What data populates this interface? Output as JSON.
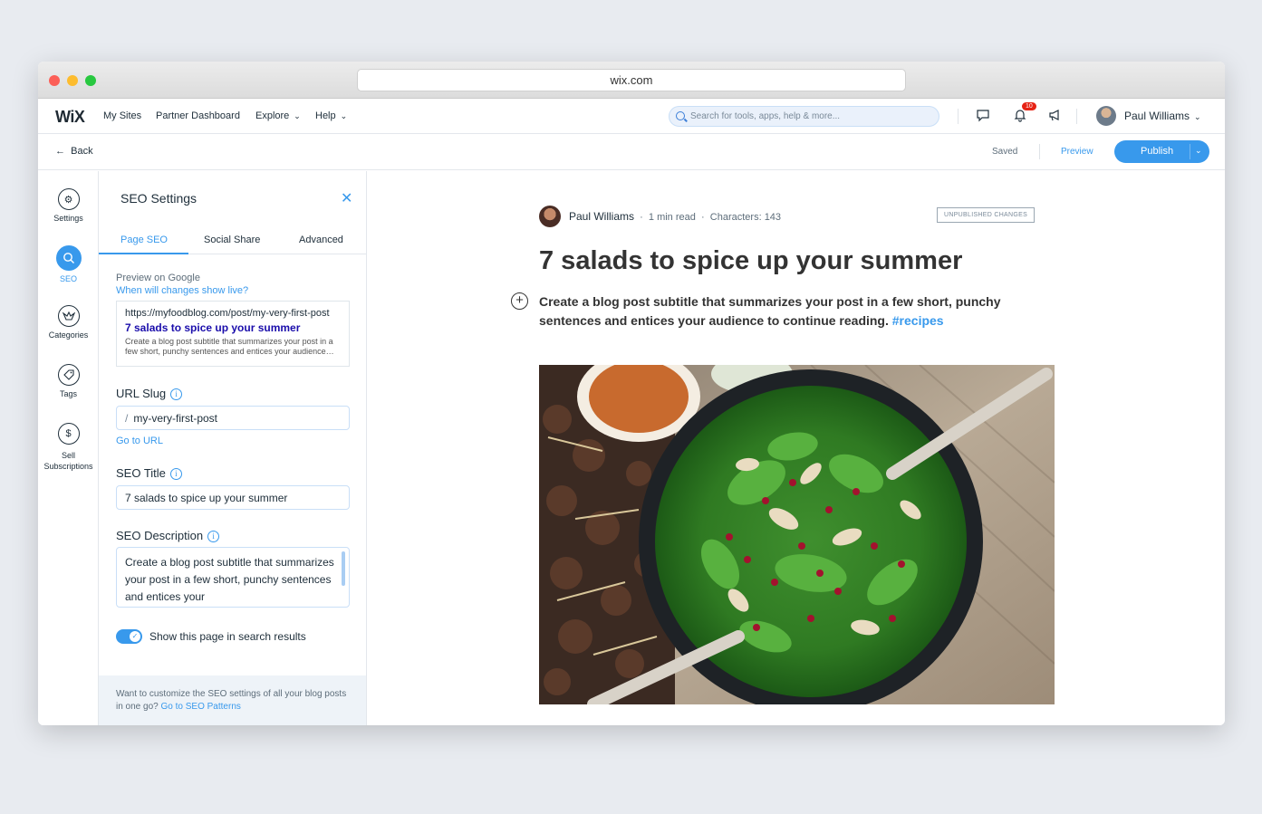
{
  "browser": {
    "url": "wix.com"
  },
  "topnav": {
    "logo": "WiX",
    "items": [
      "My Sites",
      "Partner Dashboard",
      "Explore",
      "Help"
    ],
    "search_placeholder": "Search for tools, apps, help & more...",
    "notification_count": "10",
    "user_name": "Paul Williams"
  },
  "subbar": {
    "back": "Back",
    "saved": "Saved",
    "preview": "Preview",
    "publish": "Publish"
  },
  "sidebar": {
    "items": [
      {
        "label": "Settings",
        "icon": "gear-icon"
      },
      {
        "label": "SEO",
        "icon": "search-icon"
      },
      {
        "label": "Categories",
        "icon": "categories-icon"
      },
      {
        "label": "Tags",
        "icon": "tag-icon"
      },
      {
        "label": "Sell",
        "label2": "Subscriptions",
        "icon": "dollar-icon"
      }
    ]
  },
  "seo_panel": {
    "title": "SEO Settings",
    "tabs": [
      "Page SEO",
      "Social Share",
      "Advanced"
    ],
    "preview_label": "Preview on Google",
    "preview_link": "When will changes show live?",
    "google": {
      "url": "https://myfoodblog.com/post/my-very-first-post",
      "title": "7 salads to spice up your summer",
      "desc_line1": "Create a blog post subtitle that summarizes your post in a",
      "desc_line2": "few short, punchy sentences and entices your audience…"
    },
    "url_slug_label": "URL Slug",
    "url_slug_value": "my-very-first-post",
    "go_to_url": "Go to URL",
    "seo_title_label": "SEO Title",
    "seo_title_value": "7 salads to spice up your summer",
    "seo_desc_label": "SEO Description",
    "seo_desc_value": "Create a blog post subtitle that summarizes your post in a few short, punchy sentences and entices your",
    "toggle_label": "Show this page in search results",
    "toggle_on": true,
    "footer_text": "Want to customize the SEO settings of all your blog posts in one go?",
    "footer_link": "Go to SEO Patterns"
  },
  "post": {
    "author": "Paul Williams",
    "read_time": "1 min read",
    "characters": "Characters: 143",
    "status": "UNPUBLISHED CHANGES",
    "title": "7 salads to spice up your summer",
    "subtitle": "Create a blog post subtitle that summarizes your post in a few short, punchy sentences and entices your audience to continue reading.",
    "hashtag": "#recipes"
  },
  "colors": {
    "accent": "#3899ec",
    "google_title": "#1a0dab",
    "badge": "#e62214"
  }
}
